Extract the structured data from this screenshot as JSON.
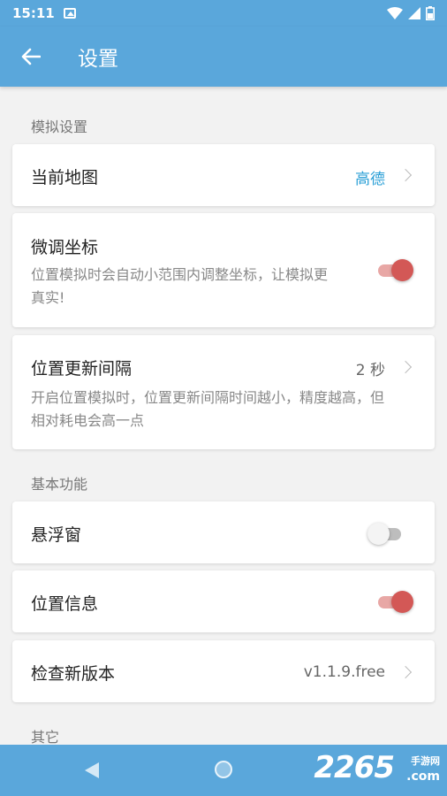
{
  "status_bar": {
    "time": "15:11"
  },
  "app_bar": {
    "title": "设置"
  },
  "sections": {
    "simulation": {
      "title": "模拟设置"
    },
    "basic": {
      "title": "基本功能"
    },
    "other": {
      "title": "其它"
    }
  },
  "items": {
    "current_map": {
      "label": "当前地图",
      "value": "高德"
    },
    "fine_tune": {
      "label": "微调坐标",
      "desc_line1": "位置模拟时会自动小范围内调整坐标，让模拟更",
      "desc_line2": "真实!",
      "enabled": true
    },
    "update_interval": {
      "label": "位置更新间隔",
      "value": "2 秒",
      "desc_line1": "开启位置模拟时，位置更新间隔时间越小，精度越高，但",
      "desc_line2": "相对耗电会高一点"
    },
    "floating_window": {
      "label": "悬浮窗",
      "enabled": false
    },
    "location_info": {
      "label": "位置信息",
      "enabled": true
    },
    "check_update": {
      "label": "检查新版本",
      "value": "v1.1.9.free"
    }
  },
  "watermark": {
    "number": "2265",
    "site": "手游网",
    "domain": ".com"
  },
  "colors": {
    "primary": "#5aa7db",
    "accent_value": "#2a9fd6",
    "toggle_on": "#d35856"
  }
}
